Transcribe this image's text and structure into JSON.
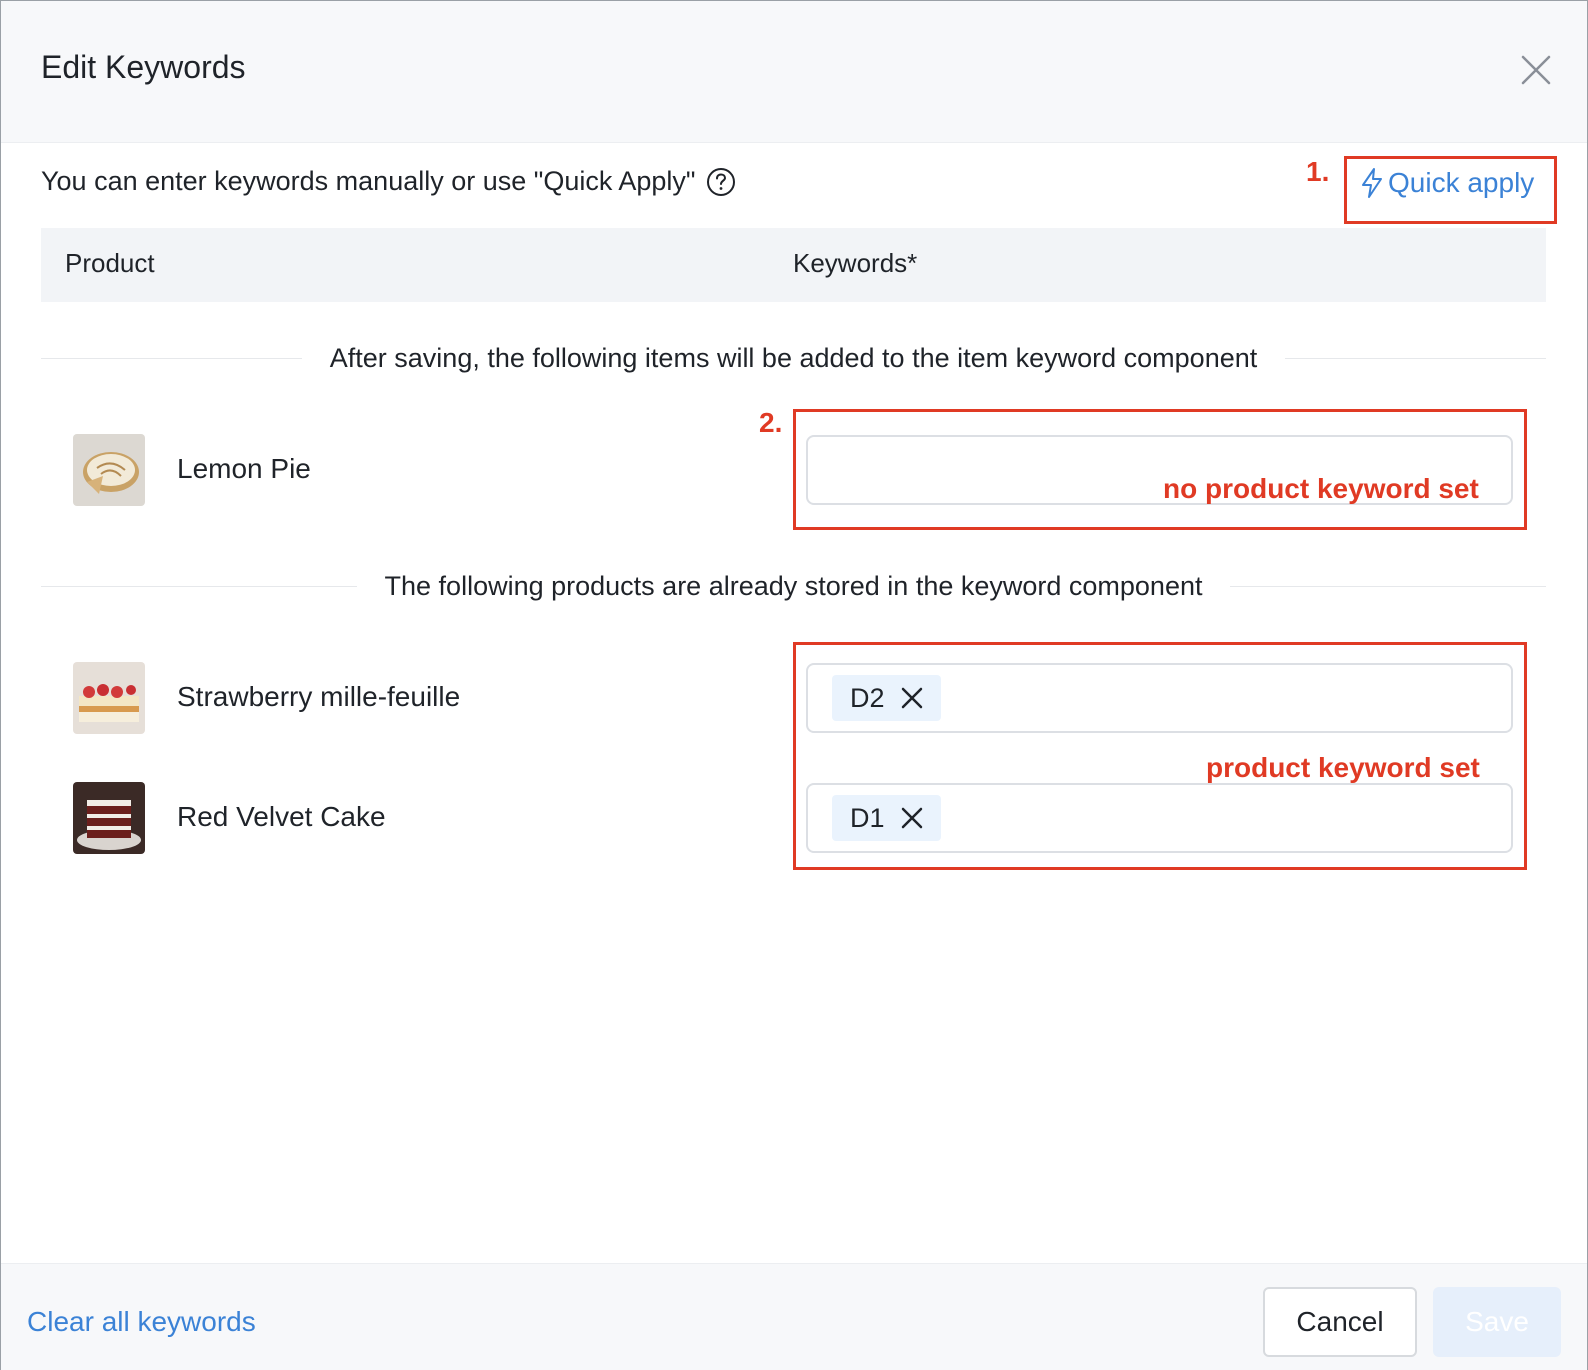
{
  "dialog": {
    "title": "Edit Keywords",
    "intro": "You can enter keywords manually or use \"Quick Apply\"",
    "quick_apply_label": "Quick apply"
  },
  "table": {
    "columns": [
      "Product",
      "Keywords*"
    ]
  },
  "sections": {
    "new_items_divider": "After saving, the following items will be added to the item keyword component",
    "stored_items_divider": "The following products are already stored in the keyword component"
  },
  "new_items": [
    {
      "name": "Lemon Pie",
      "keywords": []
    }
  ],
  "stored_items": [
    {
      "name": "Strawberry mille-feuille",
      "keywords": [
        "D2"
      ]
    },
    {
      "name": "Red Velvet Cake",
      "keywords": [
        "D1"
      ]
    }
  ],
  "annotations": {
    "step1": "1.",
    "step2": "2.",
    "no_keyword_label": "no product keyword set",
    "keyword_set_label": "product keyword set",
    "color": "#e03a24"
  },
  "footer": {
    "clear_label": "Clear all keywords",
    "cancel_label": "Cancel",
    "save_label": "Save"
  },
  "colors": {
    "link": "#3b82d6",
    "tag_bg": "#eaf3fd",
    "save_disabled_bg": "#e6effb"
  },
  "icons": {
    "close": "close-icon",
    "help": "help-circle-icon",
    "quick_apply": "lightning-icon",
    "tag_remove": "close-icon"
  }
}
